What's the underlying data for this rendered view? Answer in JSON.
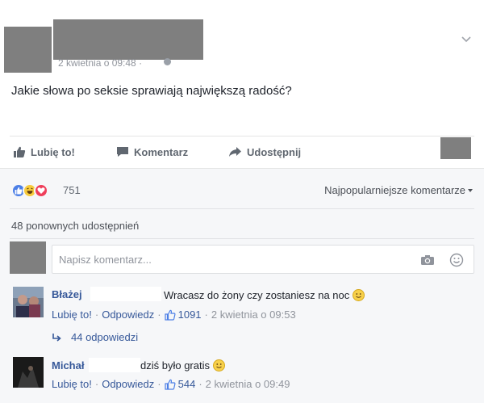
{
  "post": {
    "timestamp": "2 kwietnia o 09:48 ·",
    "text": "Jakie słowa po seksie sprawiają największą radość?"
  },
  "actions": {
    "like_label": "Lubię to!",
    "comment_label": "Komentarz",
    "share_label": "Udostępnij"
  },
  "reactions": {
    "icons": [
      "like-reaction",
      "haha-reaction",
      "love-reaction"
    ],
    "count": "751",
    "sort_label": "Najpopularniejsze komentarze"
  },
  "shares": {
    "text": "48 ponownych udostępnień"
  },
  "comment_box": {
    "placeholder": "Napisz komentarz..."
  },
  "comments": [
    {
      "author": "Błażej",
      "text": "Wracasz do żony czy zostaniesz na noc",
      "like_label": "Lubię to!",
      "reply_label": "Odpowiedz",
      "likes": "1091",
      "date": "2 kwietnia o 09:53"
    },
    {
      "author": "Michał",
      "text": "dziś było gratis",
      "like_label": "Lubię to!",
      "reply_label": "Odpowiedz",
      "likes": "544",
      "date": "2 kwietnia o 09:49"
    }
  ],
  "replies": {
    "label": "44 odpowiedzi"
  },
  "colors": {
    "link": "#365899",
    "like_blue": "#4c7fe6",
    "haha_yellow": "#f7cb3c",
    "love_red": "#ef3e5a",
    "redaction_gray": "#7f7f7f"
  }
}
